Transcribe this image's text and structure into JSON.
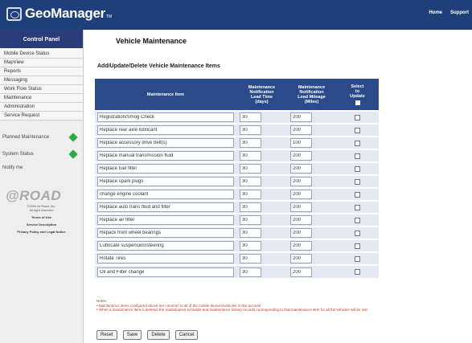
{
  "header": {
    "app_name": "GeoManager",
    "trademark": "TM",
    "links": [
      "Home",
      "Support"
    ]
  },
  "sidebar": {
    "title": "Control Panel",
    "items": [
      "Mobile Device Status",
      "MapView",
      "Reports",
      "Messaging",
      "Work Flow Status",
      "Maintenance",
      "Administration",
      "Service Request"
    ],
    "status": [
      {
        "label": "Planned Maintenance",
        "color": "#2ea84a"
      },
      {
        "label": "System Status",
        "color": "#2ea84a"
      }
    ],
    "notify": "Notify me",
    "brand": "@ROAD",
    "fine_print": [
      "©2004 At Road, Inc.",
      "All right reserved"
    ],
    "legal": [
      "Terms of Use",
      "Service Description",
      "Privacy Policy and Legal Notice"
    ]
  },
  "main": {
    "page_title": "Vehicle Maintenance",
    "section_title": "Add/Update/Delete Vehicle Maintenance Items",
    "columns": {
      "item": "Maintenance Item",
      "days": [
        "Maintenance",
        "Notification",
        "Lead Time",
        "(days)"
      ],
      "miles": [
        "Maintenance",
        "Notification",
        "Lead Mileage",
        "(Miles)"
      ],
      "select": [
        "Select",
        "to",
        "Update"
      ]
    },
    "rows": [
      {
        "item": "Registration/Smog Check",
        "days": "30",
        "miles": "200"
      },
      {
        "item": "Replace rear axle lubricant",
        "days": "30",
        "miles": "200"
      },
      {
        "item": "Replace accessory drive belt(s)",
        "days": "30",
        "miles": "100"
      },
      {
        "item": "Replace manual transmission fluid",
        "days": "30",
        "miles": "200"
      },
      {
        "item": "Replace fuel filter",
        "days": "30",
        "miles": "200"
      },
      {
        "item": "Replace spark plugs",
        "days": "30",
        "miles": "200"
      },
      {
        "item": "change engine coolant",
        "days": "30",
        "miles": "200"
      },
      {
        "item": "Replace auto trans fluid and filter",
        "days": "30",
        "miles": "200"
      },
      {
        "item": "Replace air filter",
        "days": "30",
        "miles": "200"
      },
      {
        "item": "Repack front wheel bearings",
        "days": "30",
        "miles": "200"
      },
      {
        "item": "Lubricate suspension/steering",
        "days": "30",
        "miles": "200"
      },
      {
        "item": "Rotate Tires",
        "days": "30",
        "miles": "200"
      },
      {
        "item": "Oil and Filter change",
        "days": "30",
        "miles": "200"
      }
    ],
    "notes_label": "Notes:",
    "notes": [
      "Maintenance items configured above are common to all of the mobile devices/vehicles in this account",
      "When a maintenance item is deleted, the maintenance schedule and maintenance history records corresponding to that maintenance item for all the vehicles will be lost"
    ],
    "buttons": [
      "Reset",
      "Save",
      "Delete",
      "Cancel"
    ]
  },
  "colors": {
    "header_bg": "#1f3f7a",
    "table_header_bg": "#2a4a8a",
    "row_bg": "#e4e8f2",
    "status_ok": "#2ea84a",
    "notes_text": "#c0392b"
  }
}
